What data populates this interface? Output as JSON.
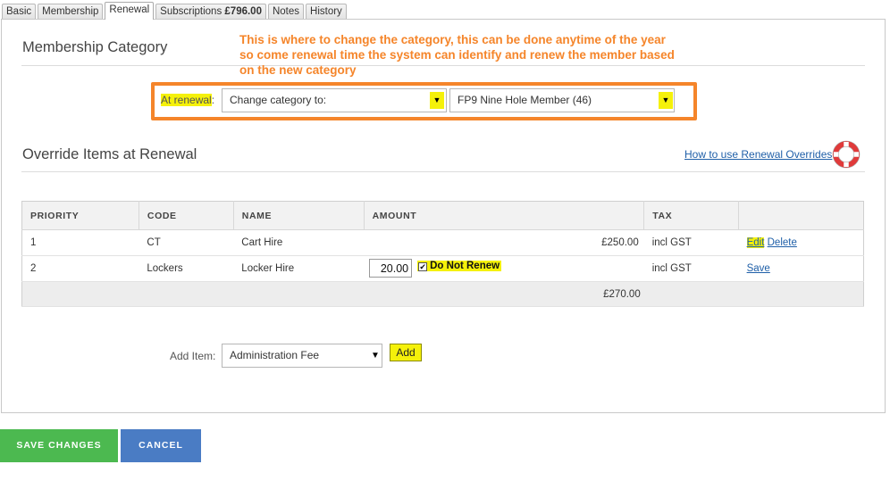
{
  "tabs": [
    {
      "label": "Basic"
    },
    {
      "label": "Membership"
    },
    {
      "label": "Renewal"
    },
    {
      "label": "Subscriptions",
      "amount": "£796.00"
    },
    {
      "label": "Notes"
    },
    {
      "label": "History"
    }
  ],
  "membership": {
    "title": "Membership Category",
    "note": "This is where to change the category, this can be done anytime of the year so come renewal time the system can identify and renew the member based on the new category",
    "at_renewal_label": "At renewal",
    "at_renewal_colon": ":",
    "action_select": "Change category to:",
    "category_select": "FP9 Nine Hole Member (46)"
  },
  "override": {
    "title": "Override Items at Renewal",
    "help_link": "How to use Renewal Overrides",
    "columns": [
      "PRIORITY",
      "CODE",
      "NAME",
      "AMOUNT",
      "TAX",
      ""
    ],
    "rows": [
      {
        "priority": "1",
        "code": "CT",
        "name": "Cart Hire",
        "amount": "£250.00",
        "tax": "incl GST",
        "edit": "Edit",
        "delete": "Delete"
      },
      {
        "priority": "2",
        "code": "Lockers",
        "name": "Locker Hire",
        "amount_input": "20.00",
        "do_not_renew": "Do Not Renew",
        "do_not_renew_checked": true,
        "tax": "incl GST",
        "save": "Save"
      }
    ],
    "total": "£270.00"
  },
  "add_item": {
    "label": "Add Item:",
    "select": "Administration Fee",
    "button": "Add"
  },
  "buttons": {
    "save": "SAVE CHANGES",
    "cancel": "CANCEL"
  },
  "colors": {
    "highlight": "#f5f10a",
    "annotation": "#f5852a",
    "save_green": "#4cb950",
    "cancel_blue": "#4a7cc4",
    "link": "#1f5fa8"
  }
}
